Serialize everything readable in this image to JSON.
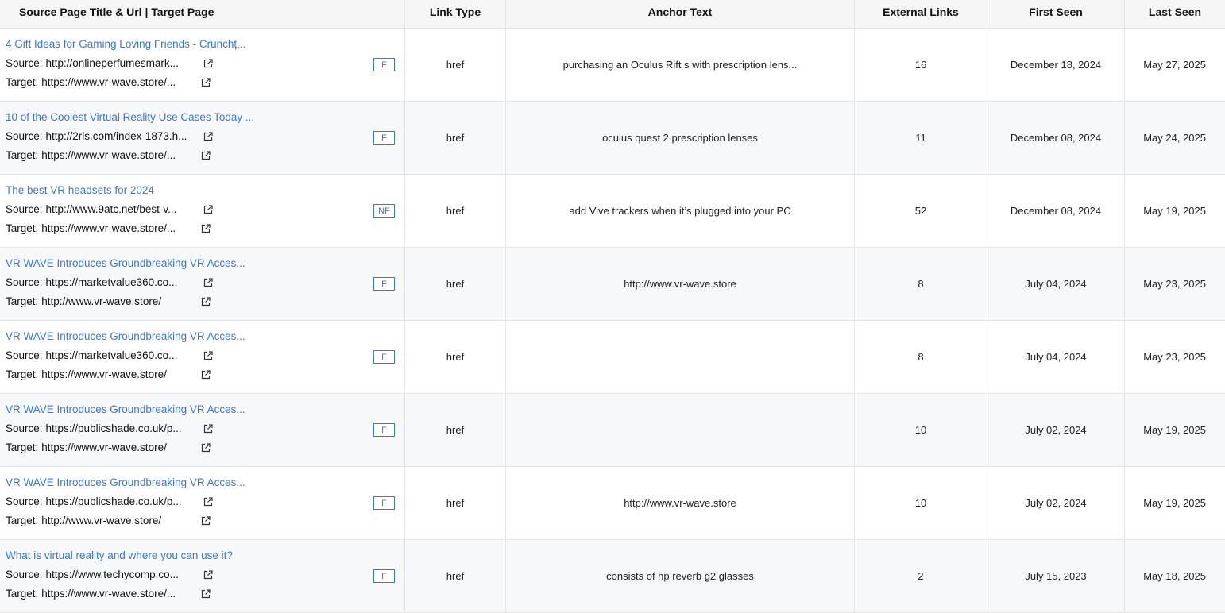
{
  "headers": {
    "source": "Source Page Title & Url | Target Page",
    "link_type": "Link Type",
    "anchor": "Anchor Text",
    "external": "External Links",
    "first_seen": "First Seen",
    "last_seen": "Last Seen"
  },
  "labels": {
    "source": "Source:",
    "target": "Target:"
  },
  "rows": [
    {
      "title": "4 Gift Ideas for Gaming Loving Friends  - Crunchț...",
      "source_url": "http://onlineperfumesmark...",
      "target_url": "https://www.vr-wave.store/...",
      "badge": "F",
      "link_type": "href",
      "anchor": "purchasing an Oculus Rift s with prescription lens...",
      "external": "16",
      "first_seen": "December 18, 2024",
      "last_seen": "May 27, 2025"
    },
    {
      "title": "10 of the Coolest Virtual Reality Use Cases Today ...",
      "source_url": "http://2rls.com/index-1873.h...",
      "target_url": "https://www.vr-wave.store/...",
      "badge": "F",
      "link_type": "href",
      "anchor": "oculus quest 2 prescription lenses",
      "external": "11",
      "first_seen": "December 08, 2024",
      "last_seen": "May 24, 2025"
    },
    {
      "title": "The best VR headsets for 2024",
      "source_url": "http://www.9atc.net/best-v...",
      "target_url": "https://www.vr-wave.store/...",
      "badge": "NF",
      "link_type": "href",
      "anchor": "add Vive trackers when it’s plugged into your PC",
      "external": "52",
      "first_seen": "December 08, 2024",
      "last_seen": "May 19, 2025"
    },
    {
      "title": "VR WAVE Introduces Groundbreaking VR Acces...",
      "source_url": "https://marketvalue360.co...",
      "target_url": "http://www.vr-wave.store/",
      "badge": "F",
      "link_type": "href",
      "anchor": "http://www.vr-wave.store",
      "external": "8",
      "first_seen": "July 04, 2024",
      "last_seen": "May 23, 2025"
    },
    {
      "title": "VR WAVE Introduces Groundbreaking VR Acces...",
      "source_url": "https://marketvalue360.co...",
      "target_url": "https://www.vr-wave.store/",
      "badge": "F",
      "link_type": "href",
      "anchor": "",
      "external": "8",
      "first_seen": "July 04, 2024",
      "last_seen": "May 23, 2025"
    },
    {
      "title": "VR WAVE Introduces Groundbreaking VR Acces...",
      "source_url": "https://publicshade.co.uk/p...",
      "target_url": "https://www.vr-wave.store/",
      "badge": "F",
      "link_type": "href",
      "anchor": "",
      "external": "10",
      "first_seen": "July 02, 2024",
      "last_seen": "May 19, 2025"
    },
    {
      "title": "VR WAVE Introduces Groundbreaking VR Acces...",
      "source_url": "https://publicshade.co.uk/p...",
      "target_url": "http://www.vr-wave.store/",
      "badge": "F",
      "link_type": "href",
      "anchor": "http://www.vr-wave.store",
      "external": "10",
      "first_seen": "July 02, 2024",
      "last_seen": "May 19, 2025"
    },
    {
      "title": "What is virtual reality and where you can use it?",
      "source_url": "https://www.techycomp.co...",
      "target_url": "https://www.vr-wave.store/...",
      "badge": "F",
      "link_type": "href",
      "anchor": "consists of hp reverb g2 glasses",
      "external": "2",
      "first_seen": "July 15, 2023",
      "last_seen": "May 18, 2025"
    }
  ]
}
